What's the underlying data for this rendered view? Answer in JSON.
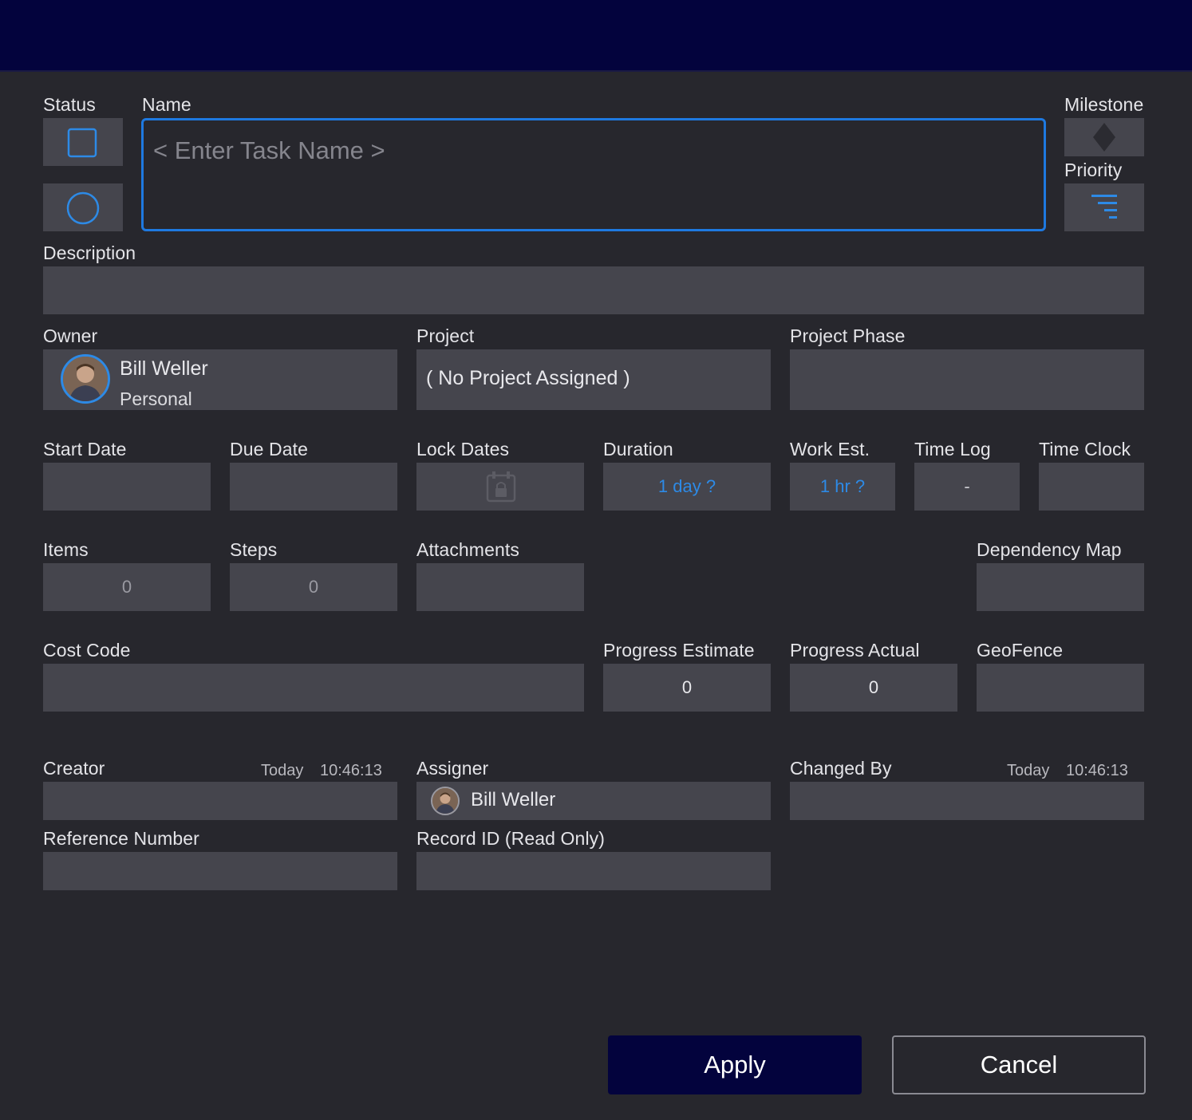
{
  "labels": {
    "status": "Status",
    "name": "Name",
    "milestone": "Milestone",
    "priority": "Priority",
    "description": "Description",
    "owner": "Owner",
    "project": "Project",
    "project_phase": "Project Phase",
    "start_date": "Start Date",
    "due_date": "Due Date",
    "lock_dates": "Lock Dates",
    "duration": "Duration",
    "work_est": "Work Est.",
    "time_log": "Time Log",
    "time_clock": "Time Clock",
    "items": "Items",
    "steps": "Steps",
    "attachments": "Attachments",
    "dependency_map": "Dependency Map",
    "cost_code": "Cost Code",
    "progress_estimate": "Progress Estimate",
    "progress_actual": "Progress Actual",
    "geofence": "GeoFence",
    "creator": "Creator",
    "assigner": "Assigner",
    "changed_by": "Changed By",
    "reference_number": "Reference Number",
    "record_id": "Record ID (Read Only)"
  },
  "name_field": {
    "placeholder": "< Enter Task Name >",
    "value": ""
  },
  "owner": {
    "name": "Bill Weller",
    "group": "Personal"
  },
  "project": {
    "value": "( No Project Assigned )"
  },
  "values": {
    "duration": "1 day ?",
    "work_est": "1 hr ?",
    "time_log": "-",
    "items": "0",
    "steps": "0",
    "progress_estimate": "0",
    "progress_actual": "0"
  },
  "creator": {
    "day": "Today",
    "time": "10:46:13"
  },
  "assigner": {
    "name": "Bill Weller"
  },
  "changed_by": {
    "day": "Today",
    "time": "10:46:13"
  },
  "buttons": {
    "apply": "Apply",
    "cancel": "Cancel"
  },
  "colors": {
    "background": "#27272d",
    "field": "#45454d",
    "titlebar": "#03033d",
    "accent_blue": "#2d8ae6",
    "apply_button": "#03033d"
  },
  "icons": {
    "status_checkbox": "square-outline-icon",
    "status_circle": "circle-outline-icon",
    "milestone": "diamond-icon",
    "priority": "priority-lines-icon",
    "lock_dates": "calendar-lock-icon"
  }
}
